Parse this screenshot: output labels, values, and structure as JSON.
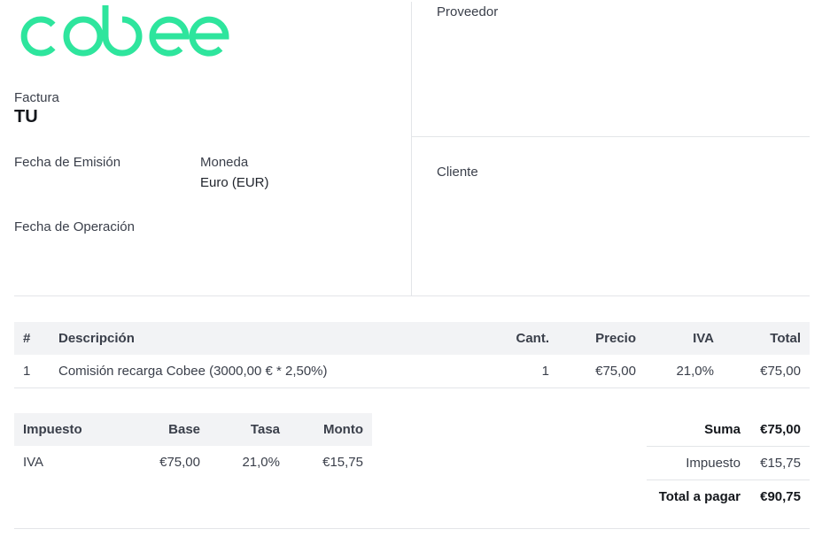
{
  "brand": {
    "logo_text": "cobee",
    "color": "#2ee59d"
  },
  "invoice": {
    "type_label": "Factura",
    "type_value": "TU",
    "issue_date_label": "Fecha de Emisión",
    "currency_label": "Moneda",
    "currency_value": "Euro (EUR)",
    "operation_date_label": "Fecha de Operación"
  },
  "parties": {
    "provider_label": "Proveedor",
    "client_label": "Cliente"
  },
  "items_table": {
    "headers": [
      "#",
      "Descripción",
      "Cant.",
      "Precio",
      "IVA",
      "Total"
    ],
    "rows": [
      [
        "1",
        "Comisión recarga Cobee (3000,00 € * 2,50%)",
        "1",
        "€75,00",
        "21,0%",
        "€75,00"
      ]
    ]
  },
  "tax_table": {
    "headers": [
      "Impuesto",
      "Base",
      "Tasa",
      "Monto"
    ],
    "rows": [
      [
        "IVA",
        "€75,00",
        "21,0%",
        "€15,75"
      ]
    ]
  },
  "totals": {
    "sum_label": "Suma",
    "sum_value": "€75,00",
    "tax_label": "Impuesto",
    "tax_value": "€15,75",
    "total_label": "Total a pagar",
    "total_value": "€90,75"
  }
}
